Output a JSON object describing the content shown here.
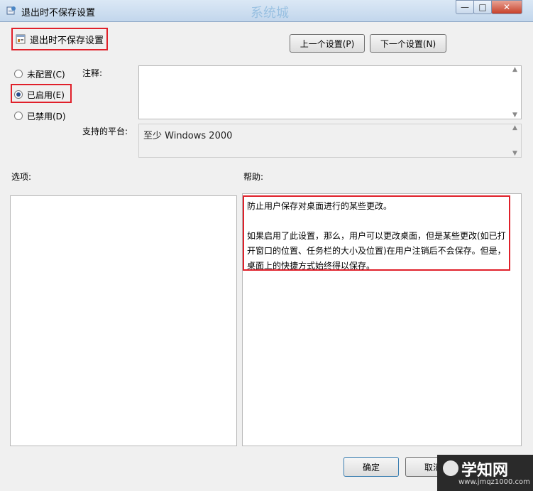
{
  "window": {
    "title": "退出时不保存设置",
    "watermark_top": "系统城"
  },
  "header": {
    "policy_name": "退出时不保存设置"
  },
  "nav": {
    "prev_label": "上一个设置(P)",
    "next_label": "下一个设置(N)"
  },
  "state": {
    "not_configured": "未配置(C)",
    "enabled": "已启用(E)",
    "disabled": "已禁用(D)",
    "selected": "enabled"
  },
  "comment": {
    "label": "注释:",
    "value": ""
  },
  "platform": {
    "label": "支持的平台:",
    "value": "至少 Windows 2000"
  },
  "options": {
    "label": "选项:"
  },
  "help": {
    "label": "帮助:",
    "text": "防止用户保存对桌面进行的某些更改。\n\n如果启用了此设置，那么，用户可以更改桌面，但是某些更改(如已打开窗口的位置、任务栏的大小及位置)在用户注销后不会保存。但是，桌面上的快捷方式始终得以保存。"
  },
  "footer": {
    "ok_label": "确定",
    "cancel_label": "取消"
  },
  "watermark": {
    "brand": "学知网",
    "url": "www.jmqz1000.com"
  },
  "colors": {
    "highlight": "#e0202a",
    "title_bar": "#c2d6ec"
  }
}
